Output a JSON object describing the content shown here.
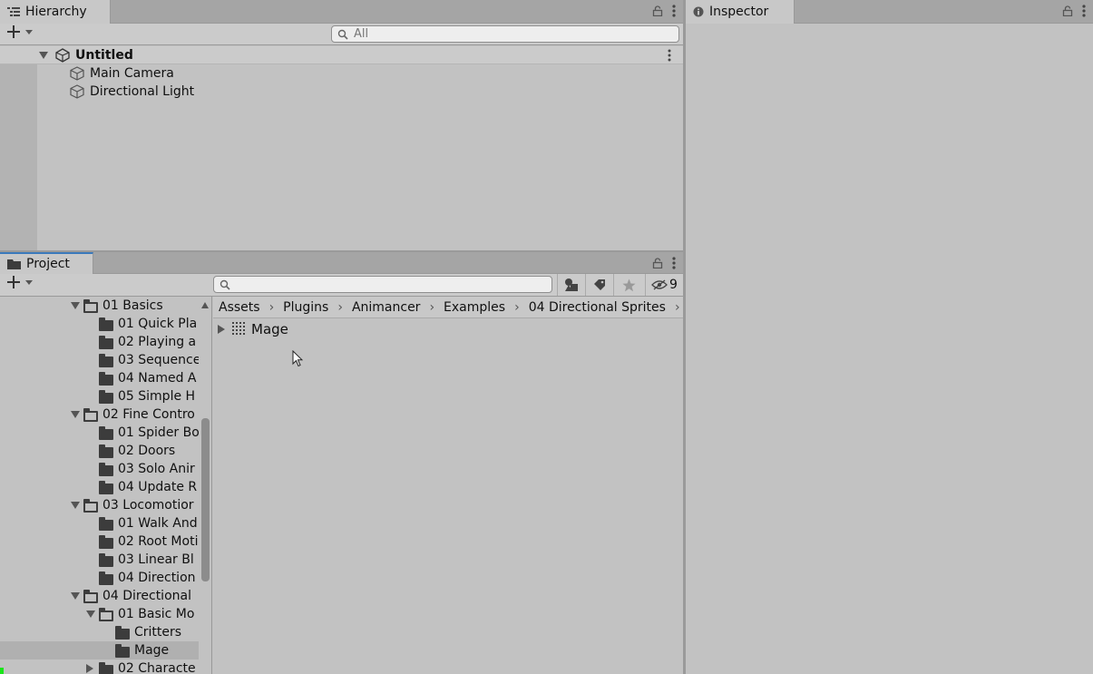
{
  "hierarchy": {
    "tab_label": "Hierarchy",
    "search_placeholder": "All",
    "scene_name": "Untitled",
    "objects": [
      "Main Camera",
      "Directional Light"
    ]
  },
  "inspector": {
    "tab_label": "Inspector"
  },
  "project": {
    "tab_label": "Project",
    "hidden_count": "9",
    "breadcrumb": [
      "Assets",
      "Plugins",
      "Animancer",
      "Examples",
      "04 Directional Sprites"
    ],
    "content_items": [
      "Mage"
    ],
    "tree": [
      {
        "label": "01 Basics",
        "level": 0,
        "expanded": true
      },
      {
        "label": "01 Quick Pla",
        "level": 1
      },
      {
        "label": "02 Playing a",
        "level": 1
      },
      {
        "label": "03 Sequence",
        "level": 1
      },
      {
        "label": "04 Named A",
        "level": 1
      },
      {
        "label": "05 Simple H",
        "level": 1
      },
      {
        "label": "02 Fine Contro",
        "level": 0,
        "expanded": true
      },
      {
        "label": "01 Spider Bo",
        "level": 1
      },
      {
        "label": "02 Doors",
        "level": 1
      },
      {
        "label": "03 Solo Anir",
        "level": 1
      },
      {
        "label": "04 Update R",
        "level": 1
      },
      {
        "label": "03 Locomotior",
        "level": 0,
        "expanded": true
      },
      {
        "label": "01 Walk And",
        "level": 1
      },
      {
        "label": "02 Root Moti",
        "level": 1
      },
      {
        "label": "03 Linear Bl",
        "level": 1
      },
      {
        "label": "04 Direction",
        "level": 1
      },
      {
        "label": "04 Directional",
        "level": 0,
        "expanded": true
      },
      {
        "label": "01 Basic Mo",
        "level": 1,
        "expanded": true
      },
      {
        "label": "Critters",
        "level": 2
      },
      {
        "label": "Mage",
        "level": 2,
        "selected": true
      },
      {
        "label": "02 Characte",
        "level": 1,
        "collapsed": true
      }
    ]
  },
  "colors": {
    "panel_bg": "#c2c2c2",
    "tab_strip": "#a5a5a5",
    "selection": "#b0b0b0",
    "active_tab_accent": "#3a79bb"
  }
}
